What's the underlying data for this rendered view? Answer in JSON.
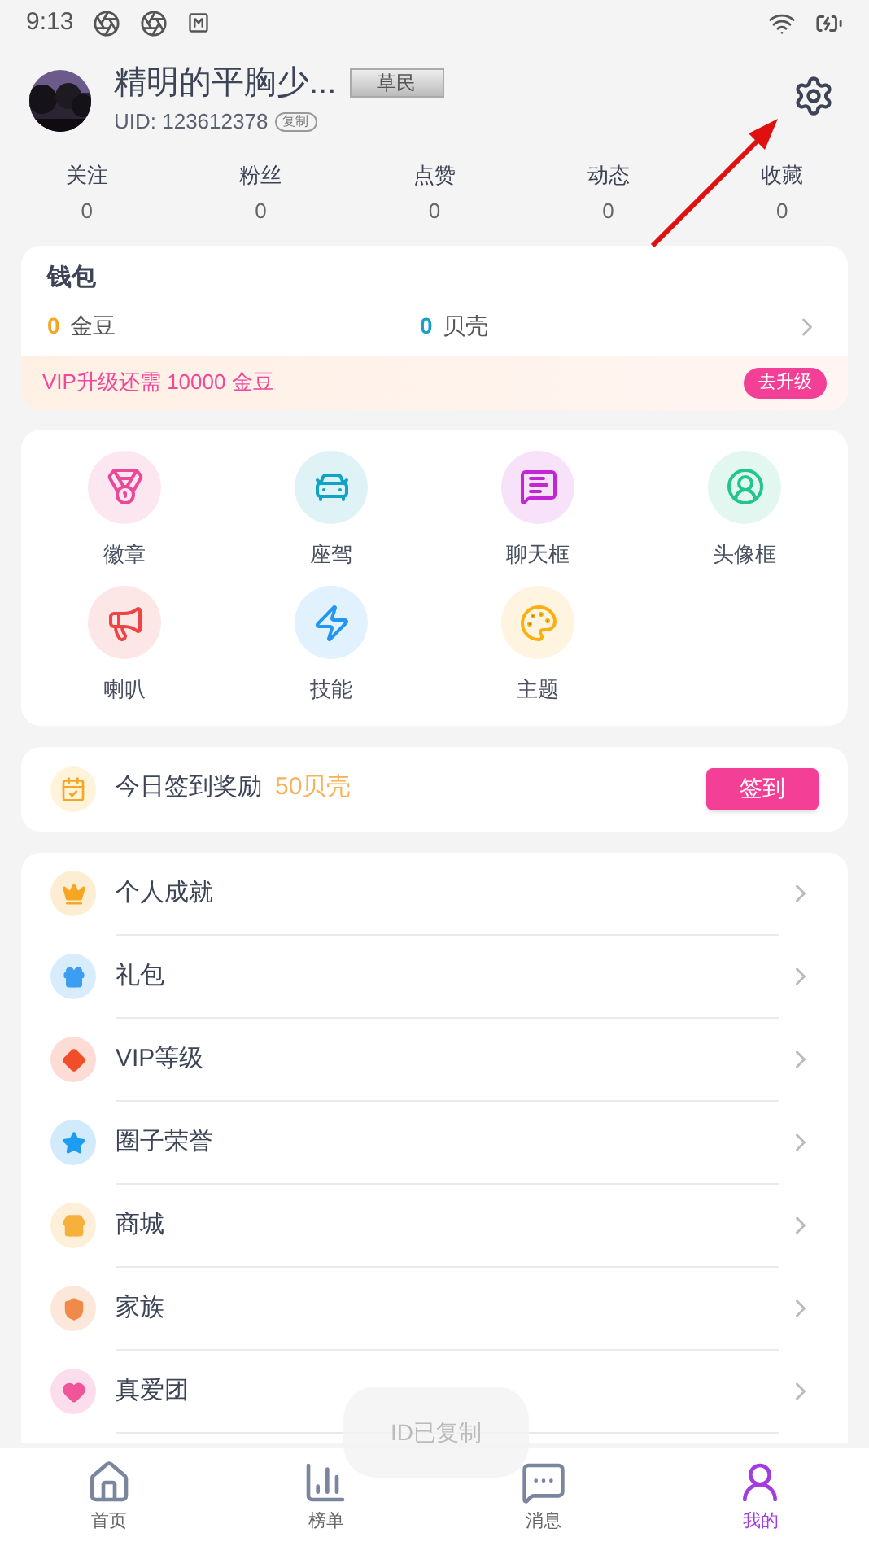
{
  "status_bar": {
    "time": "9:13"
  },
  "profile": {
    "name": "精明的平胸少...",
    "rank": "草民",
    "uid": "UID: 123612378",
    "copy": "复制"
  },
  "stats": [
    {
      "label": "关注",
      "value": "0"
    },
    {
      "label": "粉丝",
      "value": "0"
    },
    {
      "label": "点赞",
      "value": "0"
    },
    {
      "label": "动态",
      "value": "0"
    },
    {
      "label": "收藏",
      "value": "0"
    }
  ],
  "wallet": {
    "title": "钱包",
    "balances": [
      {
        "amount": "0",
        "unit": "金豆",
        "color": "#f5a623"
      },
      {
        "amount": "0",
        "unit": "贝壳",
        "color": "#17a2c4"
      }
    ],
    "vip_note": "VIP升级还需 10000 金豆",
    "upgrade": "去升级"
  },
  "features": [
    {
      "label": "徽章"
    },
    {
      "label": "座驾"
    },
    {
      "label": "聊天框"
    },
    {
      "label": "头像框"
    },
    {
      "label": "喇叭"
    },
    {
      "label": "技能"
    },
    {
      "label": "主题"
    }
  ],
  "checkin": {
    "text": "今日签到奖励",
    "reward": "50贝壳",
    "button": "签到"
  },
  "menu": [
    {
      "label": "个人成就"
    },
    {
      "label": "礼包"
    },
    {
      "label": "VIP等级"
    },
    {
      "label": "圈子荣誉"
    },
    {
      "label": "商城"
    },
    {
      "label": "家族"
    },
    {
      "label": "真爱团"
    }
  ],
  "toast": "ID已复制",
  "tabs": [
    {
      "label": "首页",
      "selected": false
    },
    {
      "label": "榜单",
      "selected": false
    },
    {
      "label": "消息",
      "selected": false
    },
    {
      "label": "我的",
      "selected": true
    }
  ]
}
